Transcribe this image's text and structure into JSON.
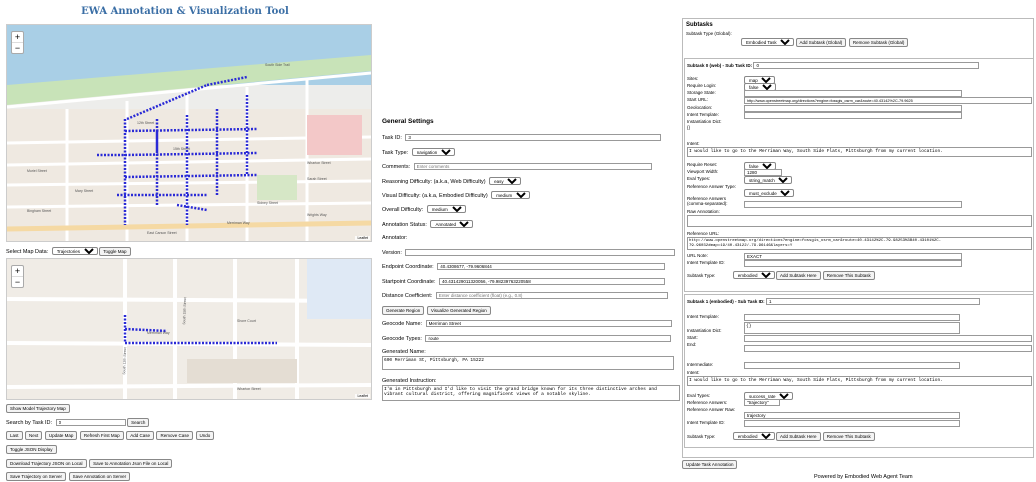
{
  "title": "EWA Annotation & Visualization Tool",
  "maps": {
    "zoom_in": "+",
    "zoom_out": "−",
    "attribution": "Leaflet",
    "top_streets": [
      "South Side Trail",
      "Muriel Street",
      "Mary Street",
      "Wharton Street",
      "Bingham Street",
      "East Carson Street",
      "Sidney Street",
      "Sarah Street",
      "Merriman Way",
      "Wrights Way",
      "15th Street",
      "12th Street"
    ],
    "bottom_streets": [
      "Merriman Way",
      "South 15th Street",
      "Shore Court",
      "Wharton Street",
      "South 13th Street"
    ],
    "route_color": "#2a2ad6"
  },
  "map_select": {
    "label": "Select Map Data:",
    "value": "Trajectories",
    "toggle": "Toggle Map"
  },
  "left_controls": {
    "show_model": "Show Model Trajectory Map",
    "search_label": "Search by Task ID:",
    "search_value": "0",
    "search_btn": "Search",
    "row1": [
      "Last",
      "Next",
      "Update Map",
      "Refresh First Map",
      "Add Case",
      "Remove Case",
      "Undo"
    ],
    "toggle_json": "Toggle JSON Display",
    "row3": [
      "Download Trajectory JSON on Local",
      "Save to Annotation Json File on Local"
    ],
    "row4": [
      "Save Trajectory on Server",
      "Save Annotation on Server"
    ]
  },
  "general": {
    "heading": "General Settings",
    "task_id_label": "Task ID:",
    "task_id": "3",
    "task_type_label": "Task Type:",
    "task_type": "navigation",
    "comments_label": "Comments:",
    "comments_ph": "Enter comments",
    "reasoning_label": "Reasoning Difficulty: (a.k.a, Web Difficulty)",
    "reasoning": "easy",
    "visual_label": "Visual Difficulty: (a.k.a, Embodied Difficulty)",
    "visual": "medium",
    "overall_label": "Overall Difficulty:",
    "overall": "medium",
    "status_label": "Annotation Status:",
    "status": "Annotated",
    "annotator_label": "Annotator:",
    "version_label": "Version:",
    "endpoint_label": "Endpoint Coordinate:",
    "endpoint": "40.4308677, -79.9606844",
    "startpoint_label": "Startpoint Coordinate:",
    "startpoint": "40.431429011320056, -79.98239763220558",
    "distance_label": "Distance Coefficient:",
    "distance_ph": "Enter distance coefficient (float) (e.g., 0.8)",
    "generate_region": "Generate Region",
    "visualize_region": "Visualize Generated Region",
    "geocode_name_label": "Geocode Name:",
    "geocode_name": "Merriman Street",
    "geocode_types_label": "Geocode Types:",
    "geocode_types": "route",
    "generated_name_label": "Generated Name:",
    "generated_name": "600 Merriman St, Pittsburgh, PA 15222",
    "generated_instr_label": "Generated Instruction:",
    "generated_instr": "I'm in Pittsburgh and I'd like to visit the grand bridge known for its three distinctive arches and vibrant cultural district, offering magnificent views of a notable skyline."
  },
  "subtasks": {
    "heading": "Subtasks",
    "type_label": "Subtask Type (Global):",
    "type_value": "Embodied Task",
    "add_global": "Add Subtask (Global)",
    "remove_global": "Remove Subtask (Global)",
    "web": {
      "header": "Subtask 0 (web) - Sub Task ID:",
      "id": "0",
      "sites_label": "Sites:",
      "sites": "map",
      "login_label": "Require Login:",
      "login": "false",
      "storage_label": "Storage State:",
      "start_url_label": "Start URL:",
      "start_url": "http://www.openstreetmap.org/directions?engine=fossgis_osrm_car&route=40.43142%2C-79.9625",
      "geolocation_label": "Geolocation:",
      "intent_template_label": "Intent Template:",
      "inst_dict_label": "Instantiation Dict:",
      "inst_dict": "{}",
      "intent_label": "Intent:",
      "intent": "I would like to go to the Merriman Way, South Side Flats, Pittsburgh from my current location.",
      "reset_label": "Require Reset:",
      "reset": "false",
      "viewport_label": "Viewport Width:",
      "viewport": "1280",
      "eval_label": "Eval Types:",
      "eval": "string_match",
      "ref_type_label": "Reference Answer Type:",
      "ref_type": "must_exclude",
      "ref_answers_label": "Reference Answers (comma-separated):",
      "raw_label": "Raw Annotation:",
      "ref_url_label": "Reference URL:",
      "ref_url": "http://www.openstreetmap.org/directions?engine=fossgis_osrm_car&route=40.43142%2C-79.98253%3B40.43101%2C-79.96032#map=19/40.43122/-79.96146&layers=Y",
      "url_note_label": "URL Note:",
      "url_note": "EXACT",
      "intent_tid_label": "Intent Template ID:",
      "subtype_label": "Subtask Type:",
      "subtype": "embodied",
      "add_here": "Add Subtask Here",
      "remove_this": "Remove This Subtask"
    },
    "emb": {
      "header": "Subtask 1 (embodied) - Sub Task ID:",
      "id": "1",
      "intent_template_label": "Intent Template:",
      "inst_dict_label": "Instantiation Dict:",
      "inst_dict": "{}",
      "start_label": "Start:",
      "end_label": "End:",
      "intermediate_label": "Intermediate:",
      "intent_label": "Intent:",
      "intent": "I would like to go to the Merriman Way, South Side Flats, Pittsburgh from my current location.",
      "eval_label": "Eval Types:",
      "eval": "success_rate",
      "ref_answers_label": "Reference Answers:",
      "ref_answers": "\"trajectory\"",
      "ref_raw_label": "Reference Answer Raw:",
      "ref_raw": "trajectory",
      "intent_tid_label": "Intent Template ID:",
      "subtype_label": "Subtask Type:",
      "subtype": "embodied",
      "add_here": "Add Subtask Here",
      "remove_this": "Remove This Subtask"
    },
    "update": "Update Task Annotation",
    "footer": "Powered by Embodied Web Agent Team"
  }
}
